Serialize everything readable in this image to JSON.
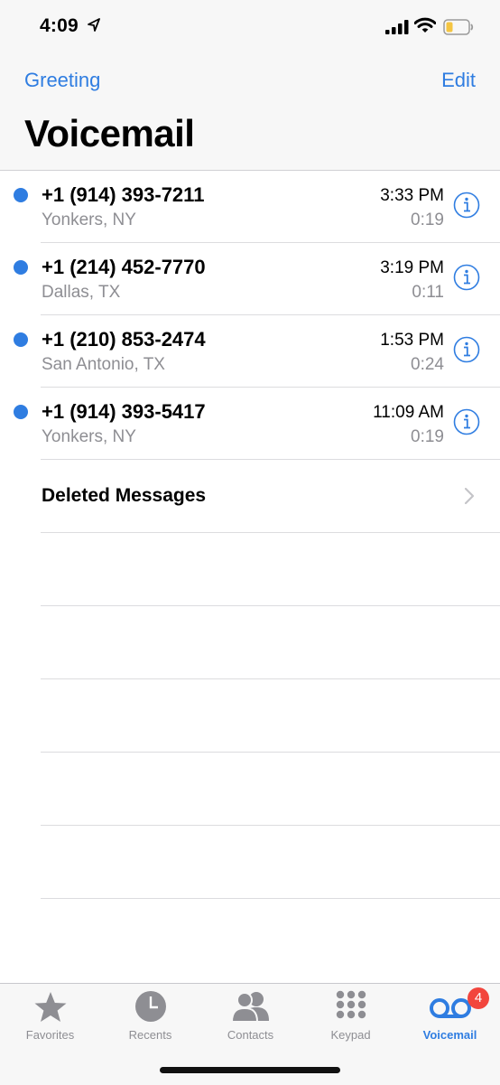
{
  "status_bar": {
    "time": "4:09"
  },
  "nav": {
    "greeting_label": "Greeting",
    "edit_label": "Edit",
    "title": "Voicemail"
  },
  "voicemails": [
    {
      "number": "+1 (914) 393-7211",
      "location": "Yonkers, NY",
      "time": "3:33 PM",
      "duration": "0:19",
      "unread": true
    },
    {
      "number": "+1 (214) 452-7770",
      "location": "Dallas, TX",
      "time": "3:19 PM",
      "duration": "0:11",
      "unread": true
    },
    {
      "number": "+1 (210) 853-2474",
      "location": "San Antonio, TX",
      "time": "1:53 PM",
      "duration": "0:24",
      "unread": true
    },
    {
      "number": "+1 (914) 393-5417",
      "location": "Yonkers, NY",
      "time": "11:09 AM",
      "duration": "0:19",
      "unread": true
    }
  ],
  "deleted_messages_label": "Deleted Messages",
  "tabs": [
    {
      "label": "Favorites",
      "icon": "star-icon"
    },
    {
      "label": "Recents",
      "icon": "clock-icon"
    },
    {
      "label": "Contacts",
      "icon": "contacts-icon"
    },
    {
      "label": "Keypad",
      "icon": "keypad-icon"
    },
    {
      "label": "Voicemail",
      "icon": "voicemail-icon",
      "active": true,
      "badge": "4"
    }
  ],
  "colors": {
    "accent": "#2f7de1",
    "badge": "#f2453d",
    "secondary_text": "#8e8e93"
  }
}
